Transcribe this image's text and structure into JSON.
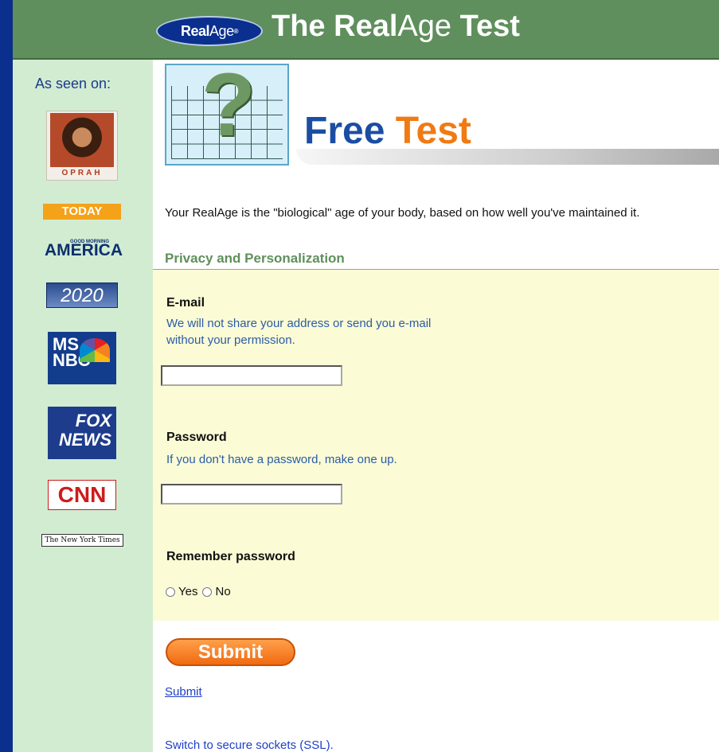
{
  "header": {
    "logo_bold": "Real",
    "logo_light": "Age",
    "logo_mark": "®",
    "title_bold1": "The ",
    "title_real": "Real",
    "title_age": "Age",
    "title_bold2": " Test"
  },
  "sidebar": {
    "heading": "As seen on:",
    "logos": {
      "oprah": "OPRAH",
      "today": "TODAY",
      "gma_small": "GOOD MORNING",
      "gma": "AMERICA",
      "twenty": "2020",
      "msnbc": "MS NBC",
      "fox": "FOX NEWS",
      "cnn": "CNN",
      "nyt": "The New York Times"
    }
  },
  "banner": {
    "free": "Free ",
    "test": "Test"
  },
  "intro": "Your RealAge is the \"biological\" age of your body, based on how well you've maintained it.",
  "privacy": {
    "title": "Privacy and Personalization"
  },
  "form": {
    "email_label": "E-mail",
    "email_hint": "We will not share your address or send you e-mail without your permission.",
    "email_value": "",
    "password_label": "Password",
    "password_hint": "If you don't have a password, make one up.",
    "password_value": "",
    "remember_label": "Remember password",
    "remember_yes": "Yes",
    "remember_no": "No"
  },
  "actions": {
    "submit_button": "Submit",
    "submit_link": "Submit",
    "ssl_link": "Switch to secure sockets (SSL)."
  },
  "colors": {
    "page_bg": "#0a2f8c",
    "header_bg": "#5f8f5c",
    "sidebar_bg": "#d2ecd2",
    "form_bg": "#fbfbd6",
    "accent_orange": "#f07a13",
    "link_blue": "#1f3fc4"
  }
}
